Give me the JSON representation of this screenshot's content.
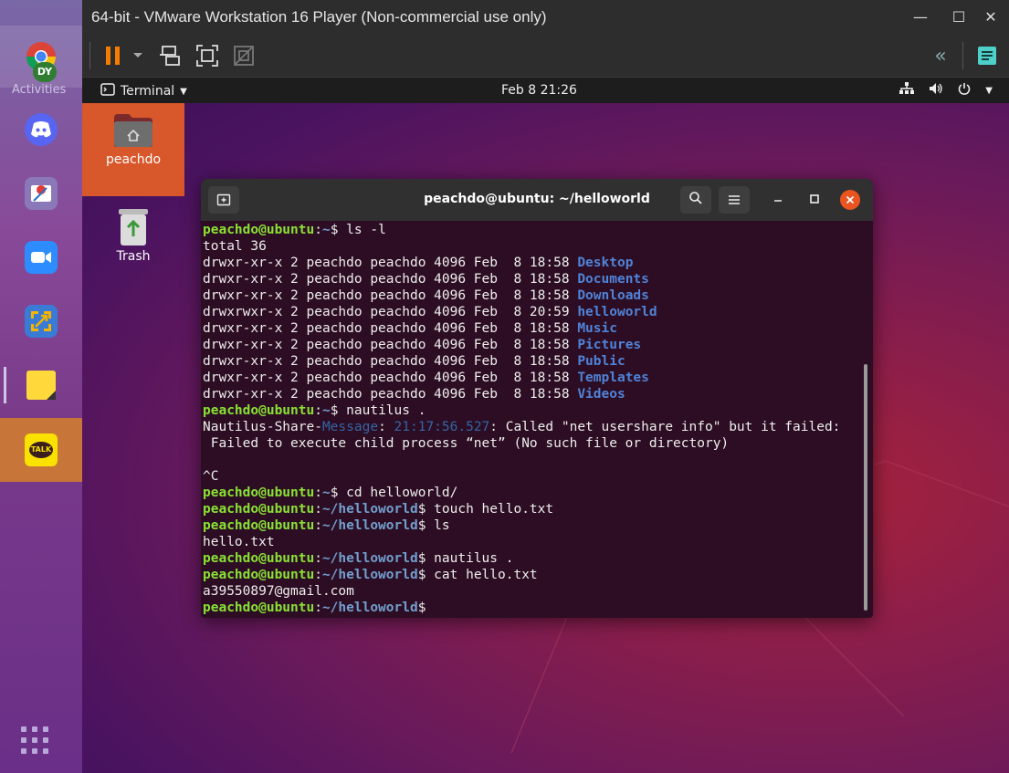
{
  "vmware": {
    "title": "64-bit - VMware Workstation 16 Player (Non-commercial use only)",
    "toolbar": {
      "pause": "pause-icon",
      "send_keys": "send-ctrl-alt-del-icon",
      "fullscreen": "fullscreen-icon",
      "unity": "unity-icon",
      "back": "«",
      "library": "library-icon"
    }
  },
  "taskbar": {
    "activities": "Activities",
    "apps": [
      "chrome-icon",
      "discord-icon",
      "snipping-icon",
      "zoom-icon",
      "vmware-icon",
      "sticky-notes-icon",
      "kakaotalk-icon",
      "app-grid-icon"
    ],
    "kakao_label": "TALK"
  },
  "gnome": {
    "app_menu": "Terminal",
    "clock": "Feb 8  21:26"
  },
  "desktop": {
    "icons": [
      {
        "label": "peachdo"
      },
      {
        "label": "Trash"
      }
    ]
  },
  "terminal": {
    "title": "peachdo@ubuntu: ~/helloworld",
    "lines": [
      [
        {
          "t": "peachdo@ubuntu",
          "c": "u"
        },
        {
          "t": ":"
        },
        {
          "t": "~",
          "c": "p"
        },
        {
          "t": "$ ls -l"
        }
      ],
      [
        {
          "t": "total 36"
        }
      ],
      [
        {
          "t": "drwxr-xr-x 2 peachdo peachdo 4096 Feb  8 18:58 "
        },
        {
          "t": "Desktop",
          "c": "d"
        }
      ],
      [
        {
          "t": "drwxr-xr-x 2 peachdo peachdo 4096 Feb  8 18:58 "
        },
        {
          "t": "Documents",
          "c": "d"
        }
      ],
      [
        {
          "t": "drwxr-xr-x 2 peachdo peachdo 4096 Feb  8 18:58 "
        },
        {
          "t": "Downloads",
          "c": "d"
        }
      ],
      [
        {
          "t": "drwxrwxr-x 2 peachdo peachdo 4096 Feb  8 20:59 "
        },
        {
          "t": "helloworld",
          "c": "d"
        }
      ],
      [
        {
          "t": "drwxr-xr-x 2 peachdo peachdo 4096 Feb  8 18:58 "
        },
        {
          "t": "Music",
          "c": "d"
        }
      ],
      [
        {
          "t": "drwxr-xr-x 2 peachdo peachdo 4096 Feb  8 18:58 "
        },
        {
          "t": "Pictures",
          "c": "d"
        }
      ],
      [
        {
          "t": "drwxr-xr-x 2 peachdo peachdo 4096 Feb  8 18:58 "
        },
        {
          "t": "Public",
          "c": "d"
        }
      ],
      [
        {
          "t": "drwxr-xr-x 2 peachdo peachdo 4096 Feb  8 18:58 "
        },
        {
          "t": "Templates",
          "c": "d"
        }
      ],
      [
        {
          "t": "drwxr-xr-x 2 peachdo peachdo 4096 Feb  8 18:58 "
        },
        {
          "t": "Videos",
          "c": "d"
        }
      ],
      [
        {
          "t": "peachdo@ubuntu",
          "c": "u"
        },
        {
          "t": ":"
        },
        {
          "t": "~",
          "c": "p"
        },
        {
          "t": "$ nautilus ."
        }
      ],
      [
        {
          "t": "Nautilus-Share-"
        },
        {
          "t": "Message",
          "c": "m"
        },
        {
          "t": ": "
        },
        {
          "t": "21:17:56.527",
          "c": "m"
        },
        {
          "t": ": Called \"net usershare info\" but it failed:"
        }
      ],
      [
        {
          "t": " Failed to execute child process “net” (No such file or directory)"
        }
      ],
      [
        {
          "t": ""
        }
      ],
      [
        {
          "t": "^C"
        }
      ],
      [
        {
          "t": "peachdo@ubuntu",
          "c": "u"
        },
        {
          "t": ":"
        },
        {
          "t": "~",
          "c": "p"
        },
        {
          "t": "$ cd helloworld/"
        }
      ],
      [
        {
          "t": "peachdo@ubuntu",
          "c": "u"
        },
        {
          "t": ":"
        },
        {
          "t": "~/helloworld",
          "c": "p"
        },
        {
          "t": "$ touch hello.txt"
        }
      ],
      [
        {
          "t": "peachdo@ubuntu",
          "c": "u"
        },
        {
          "t": ":"
        },
        {
          "t": "~/helloworld",
          "c": "p"
        },
        {
          "t": "$ ls"
        }
      ],
      [
        {
          "t": "hello.txt"
        }
      ],
      [
        {
          "t": "peachdo@ubuntu",
          "c": "u"
        },
        {
          "t": ":"
        },
        {
          "t": "~/helloworld",
          "c": "p"
        },
        {
          "t": "$ nautilus ."
        }
      ],
      [
        {
          "t": "peachdo@ubuntu",
          "c": "u"
        },
        {
          "t": ":"
        },
        {
          "t": "~/helloworld",
          "c": "p"
        },
        {
          "t": "$ cat hello.txt"
        }
      ],
      [
        {
          "t": "a39550897@gmail.com"
        }
      ],
      [
        {
          "t": "peachdo@ubuntu",
          "c": "u"
        },
        {
          "t": ":"
        },
        {
          "t": "~/helloworld",
          "c": "p"
        },
        {
          "t": "$"
        }
      ]
    ]
  },
  "colors": {
    "terminal_bg": "#2c0d23",
    "prompt_user": "#8ae234",
    "prompt_path": "#729fcf",
    "close_button": "#e95420"
  }
}
